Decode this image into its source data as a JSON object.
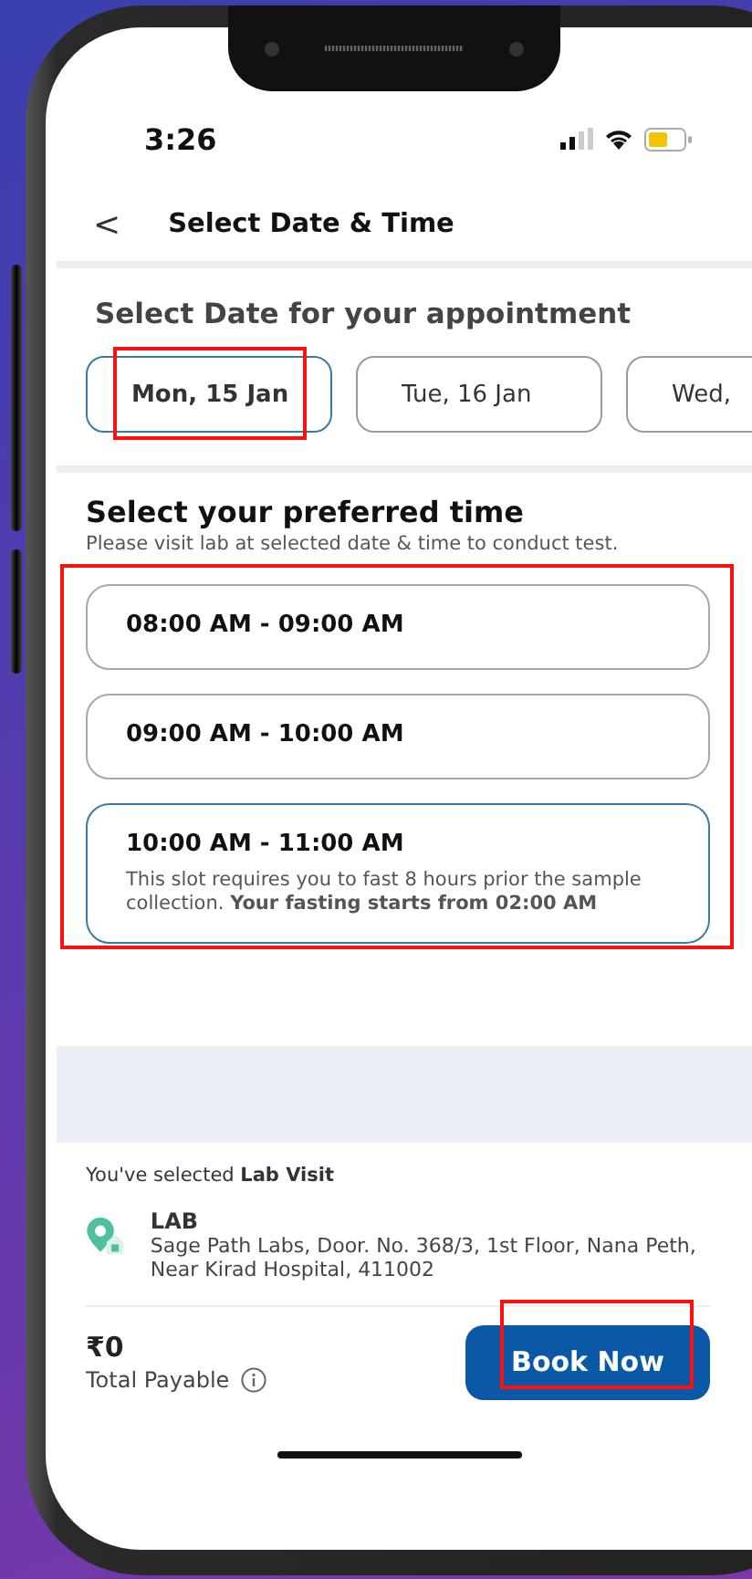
{
  "status_bar": {
    "time": "3:26"
  },
  "header": {
    "back": "<",
    "title": "Select Date & Time"
  },
  "date_section": {
    "title": "Select Date for your appointment",
    "dates": [
      {
        "label": "Mon, 15 Jan",
        "selected": true
      },
      {
        "label": "Tue, 16 Jan",
        "selected": false
      },
      {
        "label": "Wed,",
        "selected": false
      }
    ]
  },
  "time_section": {
    "title": "Select your preferred time",
    "subtitle": "Please visit lab at selected date & time to conduct test.",
    "slots": [
      {
        "label": "08:00 AM - 09:00 AM",
        "selected": false
      },
      {
        "label": "09:00 AM - 10:00 AM",
        "selected": false
      },
      {
        "label": "10:00 AM - 11:00 AM",
        "selected": true,
        "note": "This slot requires you to fast 8 hours prior the sample collection. **Your fasting starts from 02:00 AM**"
      }
    ]
  },
  "summary": {
    "selected_text": "You've selected **Lab Visit**",
    "lab_title": "LAB",
    "lab_address": "Sage Path Labs, Door. No. 368/3, 1st Floor, Nana Peth, Near Kirad Hospital, 411002",
    "amount": "₹0",
    "amount_label": "Total Payable",
    "button": "Book Now"
  }
}
